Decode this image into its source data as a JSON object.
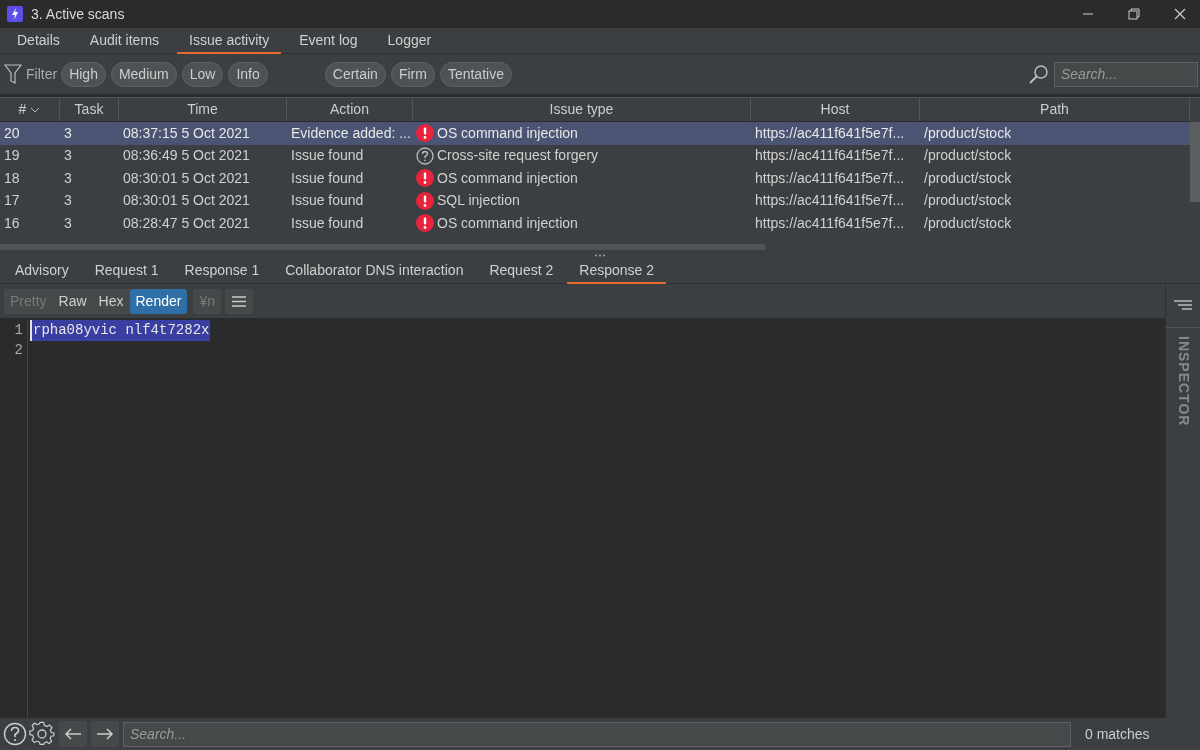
{
  "window": {
    "title": "3. Active scans"
  },
  "tabs": [
    {
      "label": "Details",
      "selected": false
    },
    {
      "label": "Audit items",
      "selected": false
    },
    {
      "label": "Issue activity",
      "selected": true
    },
    {
      "label": "Event log",
      "selected": false
    },
    {
      "label": "Logger",
      "selected": false
    }
  ],
  "filter": {
    "label": "Filter",
    "severity_chips": [
      "High",
      "Medium",
      "Low",
      "Info"
    ],
    "confidence_chips": [
      "Certain",
      "Firm",
      "Tentative"
    ],
    "search": {
      "placeholder": "Search..."
    }
  },
  "table": {
    "columns": [
      "#",
      "Task",
      "Time",
      "Action",
      "Issue type",
      "Host",
      "Path"
    ],
    "rows": [
      {
        "selected": true,
        "kind": "exclamation",
        "cells": [
          "20",
          "3",
          "08:37:15 5 Oct 2021",
          "Evidence added: ...",
          "OS command injection",
          "https://ac411f641f5e7f...",
          "/product/stock"
        ]
      },
      {
        "selected": false,
        "kind": "question",
        "cells": [
          "19",
          "3",
          "08:36:49 5 Oct 2021",
          "Issue found",
          "Cross-site request forgery",
          "https://ac411f641f5e7f...",
          "/product/stock"
        ]
      },
      {
        "selected": false,
        "kind": "exclamation",
        "cells": [
          "18",
          "3",
          "08:30:01 5 Oct 2021",
          "Issue found",
          "OS command injection",
          "https://ac411f641f5e7f...",
          "/product/stock"
        ]
      },
      {
        "selected": false,
        "kind": "exclamation",
        "cells": [
          "17",
          "3",
          "08:30:01 5 Oct 2021",
          "Issue found",
          "SQL injection",
          "https://ac411f641f5e7f...",
          "/product/stock"
        ]
      },
      {
        "selected": false,
        "kind": "exclamation",
        "cells": [
          "16",
          "3",
          "08:28:47 5 Oct 2021",
          "Issue found",
          "OS command injection",
          "https://ac411f641f5e7f...",
          "/product/stock"
        ]
      }
    ]
  },
  "detail_tabs": [
    {
      "label": "Advisory",
      "selected": false
    },
    {
      "label": "Request 1",
      "selected": false
    },
    {
      "label": "Response 1",
      "selected": false
    },
    {
      "label": "Collaborator DNS interaction",
      "selected": false
    },
    {
      "label": "Request 2",
      "selected": false
    },
    {
      "label": "Response 2",
      "selected": true
    }
  ],
  "view_modes": [
    {
      "label": "Pretty",
      "selected": false,
      "disabled": true
    },
    {
      "label": "Raw",
      "selected": false,
      "disabled": false
    },
    {
      "label": "Hex",
      "selected": false,
      "disabled": false
    },
    {
      "label": "Render",
      "selected": true,
      "disabled": false
    }
  ],
  "newline_toggle": {
    "label": "¥n",
    "disabled": true
  },
  "editor": {
    "line_numbers": [
      "1",
      "2"
    ],
    "text": "rpha08yvic nlf4t7282x",
    "selected": true
  },
  "inspector": {
    "label": "INSPECTOR"
  },
  "search_bar": {
    "placeholder": "Search...",
    "matches": "0 matches"
  }
}
